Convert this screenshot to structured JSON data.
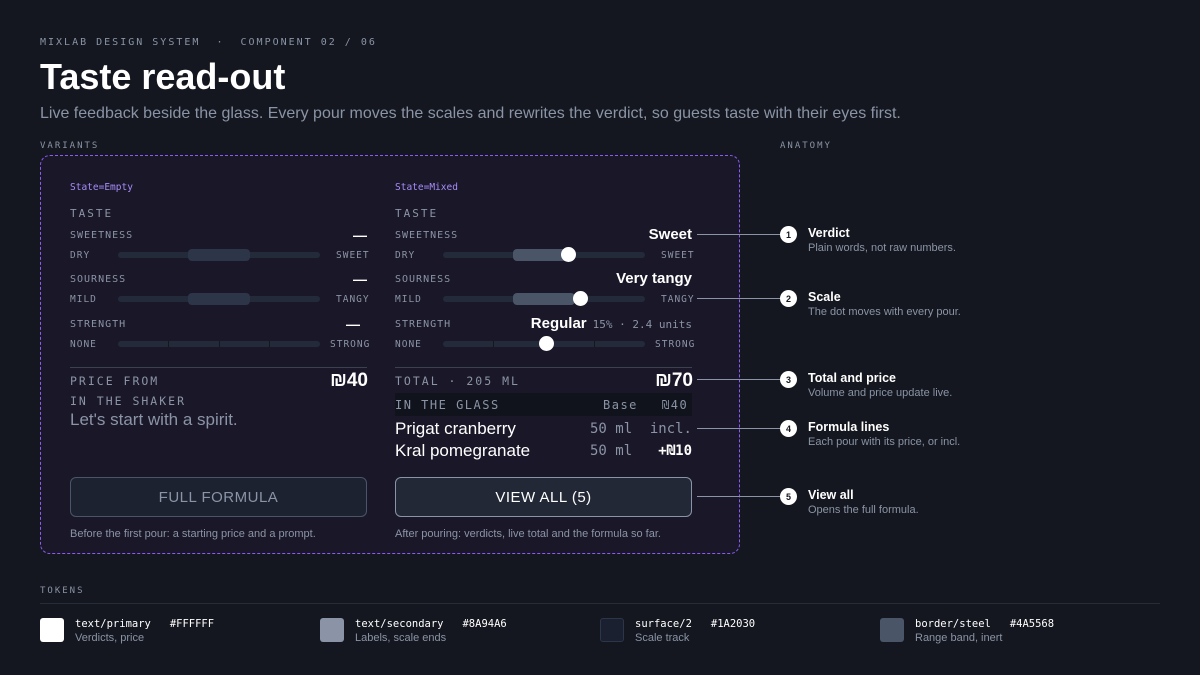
{
  "header": {
    "eyebrow": "MIXLAB DESIGN SYSTEM  ·  COMPONENT 02 / 06",
    "title": "Taste read-out",
    "subtitle": "Live feedback beside the glass. Every pour moves the scales and rewrites the verdict, so guests taste with their eyes first."
  },
  "sections": {
    "variants": "VARIANTS",
    "anatomy": "ANATOMY",
    "tokens": "TOKENS"
  },
  "empty": {
    "state": "State=Empty",
    "taste_label": "TASTE",
    "rows": [
      {
        "name": "SWEETNESS",
        "verdict": "—",
        "left": "DRY",
        "right": "SWEET"
      },
      {
        "name": "SOURNESS",
        "verdict": "—",
        "left": "MILD",
        "right": "TANGY"
      },
      {
        "name": "STRENGTH",
        "verdict": "—",
        "left": "NONE",
        "right": "STRONG"
      }
    ],
    "price_label": "PRICE FROM",
    "price": "₪40",
    "shaker_label": "IN THE SHAKER",
    "prompt": "Let's start with a spirit.",
    "button": "FULL FORMULA",
    "caption": "Before the first pour: a starting price and a prompt."
  },
  "mixed": {
    "state": "State=Mixed",
    "taste_label": "TASTE",
    "rows": [
      {
        "name": "SWEETNESS",
        "verdict": "Sweet",
        "left": "DRY",
        "right": "SWEET",
        "level": 0.62
      },
      {
        "name": "SOURNESS",
        "verdict": "Very tangy",
        "left": "MILD",
        "right": "TANGY",
        "level": 0.68
      },
      {
        "name": "STRENGTH",
        "verdict": "Regular",
        "meta": "15% · 2.4 units",
        "left": "NONE",
        "right": "STRONG",
        "level": 0.51
      }
    ],
    "total_label": "TOTAL · 205 ML",
    "total_price": "₪70",
    "glass_label": "IN THE GLASS",
    "base_label": "Base",
    "base_price": "₪40",
    "formula": [
      {
        "name": "Prigat cranberry",
        "volume": "50 ml",
        "price": "incl."
      },
      {
        "name": "Kral pomegranate",
        "volume": "50 ml",
        "price": "+₪10"
      }
    ],
    "button": "VIEW ALL (5)",
    "caption": "After pouring: verdicts, live total and the formula so far."
  },
  "anatomy": [
    {
      "num": "1",
      "title": "Verdict",
      "desc": "Plain words, not raw numbers."
    },
    {
      "num": "2",
      "title": "Scale",
      "desc": "The dot moves with every pour."
    },
    {
      "num": "3",
      "title": "Total and price",
      "desc": "Volume and price update live."
    },
    {
      "num": "4",
      "title": "Formula lines",
      "desc": "Each pour with its price, or incl."
    },
    {
      "num": "5",
      "title": "View all",
      "desc": "Opens the full formula."
    }
  ],
  "tokens": [
    {
      "name": "text/primary",
      "hex": "#FFFFFF",
      "desc": "Verdicts, price",
      "color": "#FFFFFF"
    },
    {
      "name": "text/secondary",
      "hex": "#8A94A6",
      "desc": "Labels, scale ends",
      "color": "#8A94A6"
    },
    {
      "name": "surface/2",
      "hex": "#1A2030",
      "desc": "Scale track",
      "color": "#1A2030"
    },
    {
      "name": "border/steel",
      "hex": "#4A5568",
      "desc": "Range band, inert",
      "color": "#4A5568"
    }
  ]
}
